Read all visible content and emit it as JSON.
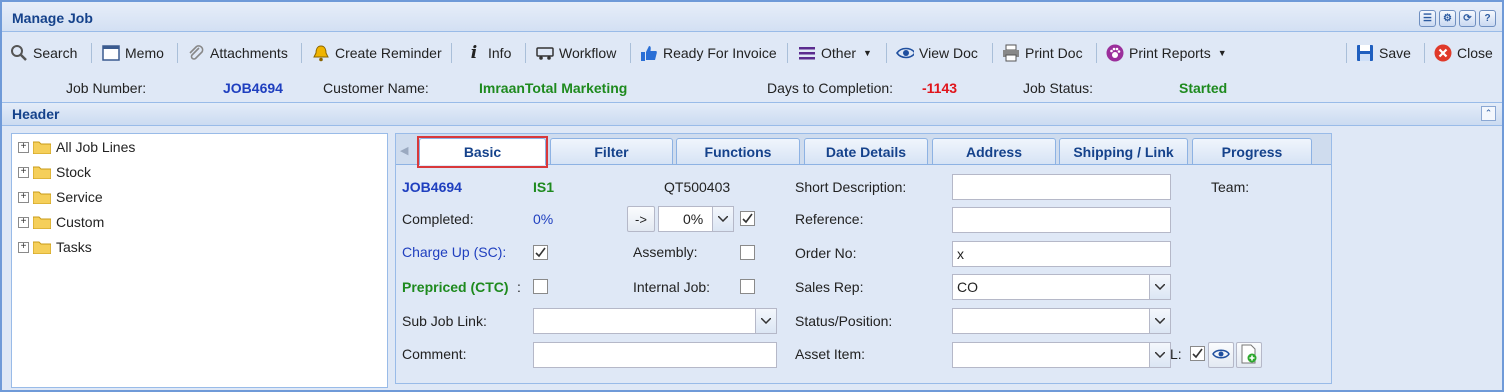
{
  "window": {
    "title": "Manage Job"
  },
  "toolbar": {
    "search": "Search",
    "memo": "Memo",
    "attachments": "Attachments",
    "create_reminder": "Create Reminder",
    "info": "Info",
    "workflow": "Workflow",
    "ready_for_invoice": "Ready For Invoice",
    "other": "Other",
    "view_doc": "View Doc",
    "print_doc": "Print Doc",
    "print_reports": "Print Reports",
    "save": "Save",
    "close": "Close"
  },
  "info": {
    "job_number_label": "Job Number:",
    "job_number": "JOB4694",
    "customer_name_label": "Customer Name:",
    "customer_name": "ImraanTotal Marketing",
    "days_label": "Days to Completion:",
    "days": "-1143",
    "status_label": "Job Status:",
    "status": "Started"
  },
  "header_section": {
    "title": "Header"
  },
  "tree": {
    "items": [
      {
        "label": "All Job Lines"
      },
      {
        "label": "Stock"
      },
      {
        "label": "Service"
      },
      {
        "label": "Custom"
      },
      {
        "label": "Tasks"
      }
    ]
  },
  "tabs": [
    {
      "label": "Basic"
    },
    {
      "label": "Filter"
    },
    {
      "label": "Functions"
    },
    {
      "label": "Date Details"
    },
    {
      "label": "Address"
    },
    {
      "label": "Shipping / Link"
    },
    {
      "label": "Progress"
    }
  ],
  "form": {
    "job_code": "JOB4694",
    "is_code": "IS1",
    "qt_code": "QT500403",
    "completed_label": "Completed:",
    "completed_value": "0%",
    "arrow_btn": "->",
    "percent_select": "0%",
    "charge_up_label": "Charge Up (SC):",
    "assembly_label": "Assembly:",
    "prepriced_label": "Prepriced (CTC)",
    "prepriced_colon": ":",
    "internal_job_label": "Internal Job:",
    "sub_job_link_label": "Sub Job Link:",
    "comment_label": "Comment:",
    "short_desc_label": "Short Description:",
    "reference_label": "Reference:",
    "order_no_label": "Order No:",
    "order_no_value": "x",
    "sales_rep_label": "Sales Rep:",
    "sales_rep_value": "CO",
    "status_position_label": "Status/Position:",
    "asset_item_label": "Asset Item:",
    "team_label": "Team:",
    "l_label": "L:"
  },
  "colors": {
    "title": "#15428b",
    "link_blue": "#1f3fbf",
    "green": "#1e8a1e",
    "red": "#e0141b",
    "highlight": "#d9383a"
  }
}
